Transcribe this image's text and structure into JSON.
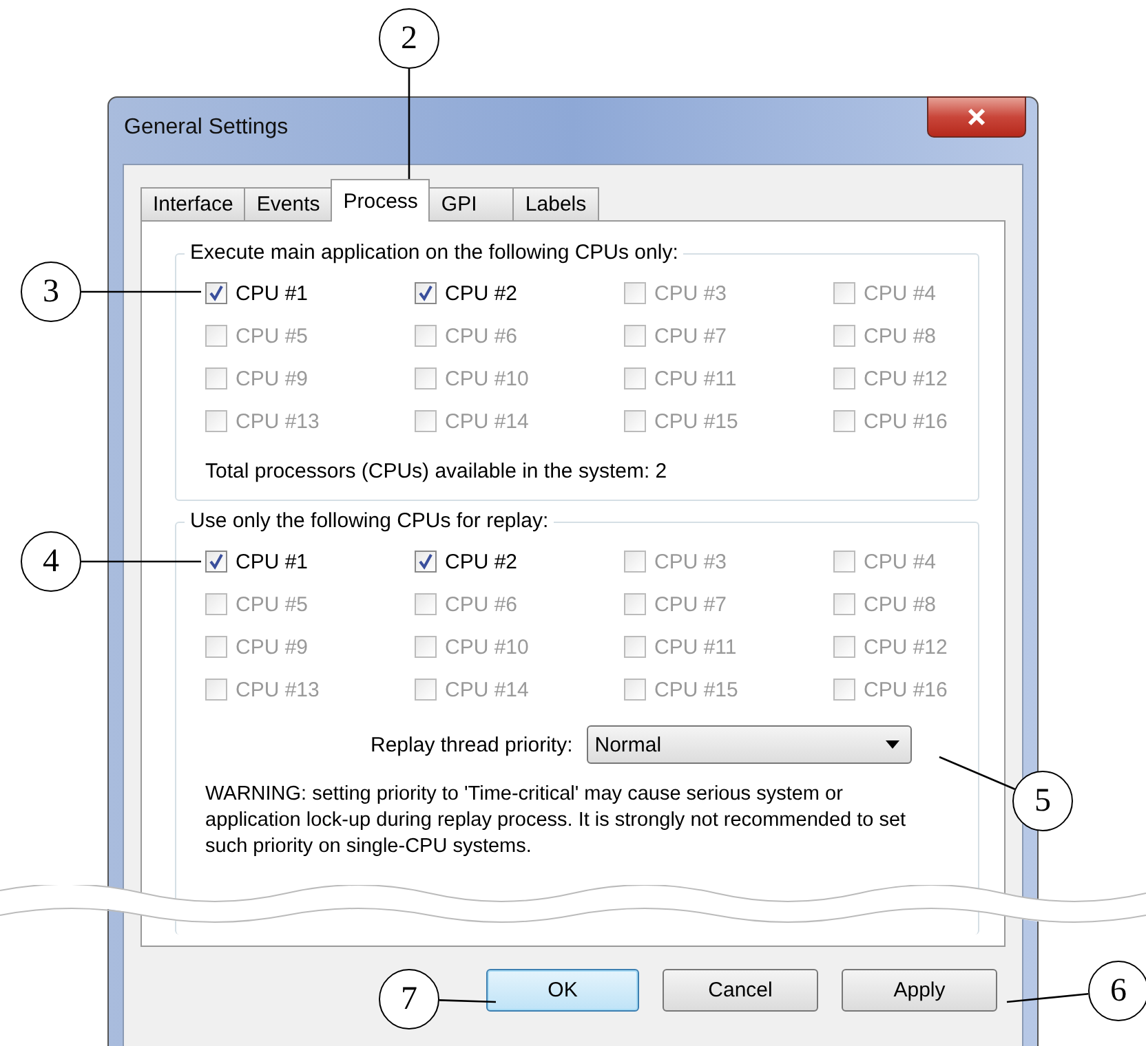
{
  "window": {
    "title": "General Settings"
  },
  "tabs": [
    {
      "label": "Interface",
      "selected": false
    },
    {
      "label": "Events",
      "selected": false
    },
    {
      "label": "Process",
      "selected": true
    },
    {
      "label": "GPI",
      "selected": false
    },
    {
      "label": "Labels",
      "selected": false
    }
  ],
  "main_cpus": {
    "legend": "Execute main application on the following CPUs only:",
    "items": [
      {
        "label": "CPU #1",
        "checked": true,
        "disabled": false
      },
      {
        "label": "CPU #2",
        "checked": true,
        "disabled": false
      },
      {
        "label": "CPU #3",
        "checked": false,
        "disabled": true
      },
      {
        "label": "CPU #4",
        "checked": false,
        "disabled": true
      },
      {
        "label": "CPU #5",
        "checked": false,
        "disabled": true
      },
      {
        "label": "CPU #6",
        "checked": false,
        "disabled": true
      },
      {
        "label": "CPU #7",
        "checked": false,
        "disabled": true
      },
      {
        "label": "CPU #8",
        "checked": false,
        "disabled": true
      },
      {
        "label": "CPU #9",
        "checked": false,
        "disabled": true
      },
      {
        "label": "CPU #10",
        "checked": false,
        "disabled": true
      },
      {
        "label": "CPU #11",
        "checked": false,
        "disabled": true
      },
      {
        "label": "CPU #12",
        "checked": false,
        "disabled": true
      },
      {
        "label": "CPU #13",
        "checked": false,
        "disabled": true
      },
      {
        "label": "CPU #14",
        "checked": false,
        "disabled": true
      },
      {
        "label": "CPU #15",
        "checked": false,
        "disabled": true
      },
      {
        "label": "CPU #16",
        "checked": false,
        "disabled": true
      }
    ],
    "total": "Total processors (CPUs) available in the system: 2"
  },
  "replay_cpus": {
    "legend": "Use only the following CPUs for replay:",
    "items": [
      {
        "label": "CPU #1",
        "checked": true,
        "disabled": false
      },
      {
        "label": "CPU #2",
        "checked": true,
        "disabled": false
      },
      {
        "label": "CPU #3",
        "checked": false,
        "disabled": true
      },
      {
        "label": "CPU #4",
        "checked": false,
        "disabled": true
      },
      {
        "label": "CPU #5",
        "checked": false,
        "disabled": true
      },
      {
        "label": "CPU #6",
        "checked": false,
        "disabled": true
      },
      {
        "label": "CPU #7",
        "checked": false,
        "disabled": true
      },
      {
        "label": "CPU #8",
        "checked": false,
        "disabled": true
      },
      {
        "label": "CPU #9",
        "checked": false,
        "disabled": true
      },
      {
        "label": "CPU #10",
        "checked": false,
        "disabled": true
      },
      {
        "label": "CPU #11",
        "checked": false,
        "disabled": true
      },
      {
        "label": "CPU #12",
        "checked": false,
        "disabled": true
      },
      {
        "label": "CPU #13",
        "checked": false,
        "disabled": true
      },
      {
        "label": "CPU #14",
        "checked": false,
        "disabled": true
      },
      {
        "label": "CPU #15",
        "checked": false,
        "disabled": true
      },
      {
        "label": "CPU #16",
        "checked": false,
        "disabled": true
      }
    ],
    "priority_label": "Replay thread priority:",
    "priority_value": "Normal",
    "warning": "WARNING: setting priority to 'Time-critical' may cause serious system or application lock-up during replay process. It is strongly not recommended to set such priority on single-CPU systems."
  },
  "buttons": [
    {
      "label": "OK",
      "default": true
    },
    {
      "label": "Cancel",
      "default": false
    },
    {
      "label": "Apply",
      "default": false
    }
  ],
  "callouts": [
    "2",
    "3",
    "4",
    "5",
    "6",
    "7"
  ]
}
